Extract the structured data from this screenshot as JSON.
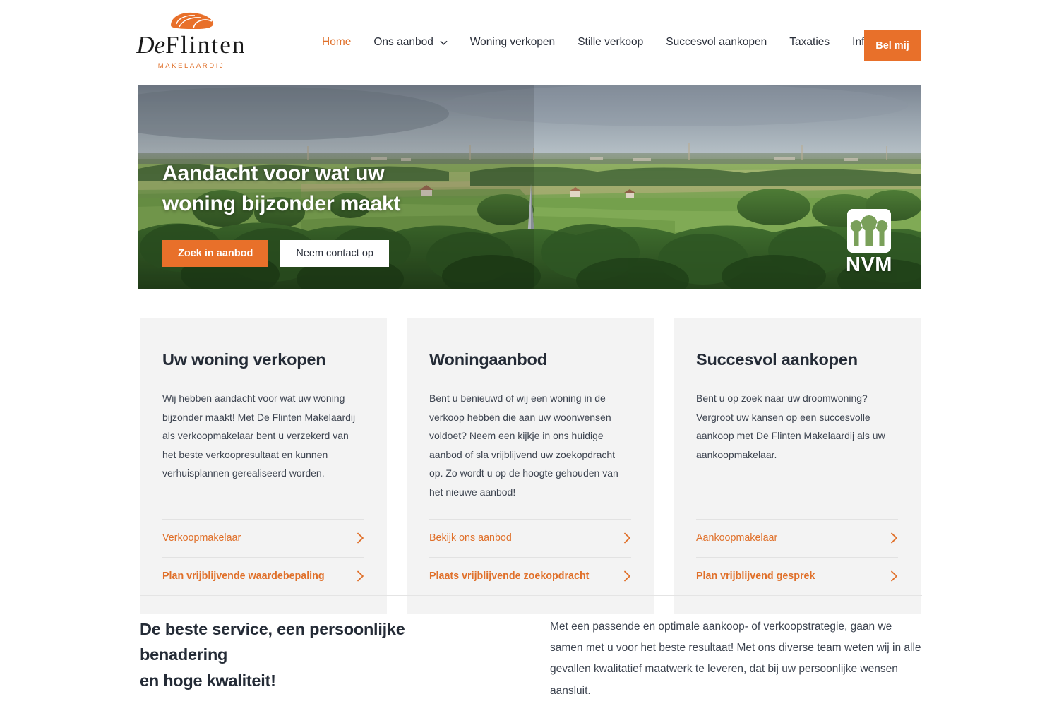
{
  "header": {
    "logo": {
      "mark_icon": "flint-stone-icon",
      "word_de": "De",
      "word_flinten": "Flinten",
      "tagline": "MAKELAARDIJ"
    },
    "nav": [
      {
        "label": "Home",
        "active": true,
        "has_dropdown": false
      },
      {
        "label": "Ons aanbod",
        "active": false,
        "has_dropdown": true
      },
      {
        "label": "Woning verkopen",
        "active": false,
        "has_dropdown": false
      },
      {
        "label": "Stille verkoop",
        "active": false,
        "has_dropdown": false
      },
      {
        "label": "Succesvol aankopen",
        "active": false,
        "has_dropdown": false
      },
      {
        "label": "Taxaties",
        "active": false,
        "has_dropdown": false
      },
      {
        "label": "Informatie",
        "active": false,
        "has_dropdown": true
      }
    ],
    "cta_label": "Bel mij"
  },
  "hero": {
    "title_line1": "Aandacht voor wat uw",
    "title_line2": "woning bijzonder maakt",
    "primary_button": "Zoek in aanbod",
    "secondary_button": "Neem contact op",
    "badge": {
      "name": "nvm-logo",
      "text": "NVM"
    },
    "image_alt": "Luchtfoto van Nederlands landschap met kerktoren, velden en bomen"
  },
  "cards": [
    {
      "title": "Uw woning verkopen",
      "body": "Wij hebben aandacht voor wat uw woning bijzonder maakt! Met De Flinten Makelaardij als verkoopmakelaar bent u verzekerd van het beste verkoopresultaat en kunnen verhuisplannen gerealiseerd worden.",
      "links": [
        {
          "label": "Verkoopmakelaar",
          "bold": false
        },
        {
          "label": "Plan vrijblijvende waardebepaling",
          "bold": true
        }
      ]
    },
    {
      "title": "Woningaanbod",
      "body": "Bent u benieuwd of wij een woning in de verkoop hebben die aan uw woonwensen voldoet? Neem een kijkje in ons huidige aanbod of sla vrijblijvend uw zoekopdracht op. Zo wordt u op de hoogte gehouden van het nieuwe aanbod!",
      "links": [
        {
          "label": "Bekijk ons aanbod",
          "bold": false
        },
        {
          "label": "Plaats vrijblijvende zoekopdracht",
          "bold": true
        }
      ]
    },
    {
      "title": "Succesvol aankopen",
      "body": "Bent u op zoek naar uw droomwoning? Vergroot uw kansen op een succesvolle aankoop met De Flinten Makelaardij als uw aankoopmakelaar.",
      "links": [
        {
          "label": "Aankoopmakelaar",
          "bold": false
        },
        {
          "label": "Plan vrijblijvend gesprek",
          "bold": true
        }
      ]
    }
  ],
  "bottom": {
    "heading_line1": "De beste service, een persoonlijke benadering",
    "heading_line2": "en hoge kwaliteit!",
    "body": "Met een passende en optimale aankoop- of verkoopstrategie, gaan we samen met u voor het beste resultaat! Met ons diverse team weten wij in alle gevallen kwalitatief maatwerk te leveren, dat bij uw persoonlijke wensen aansluit."
  },
  "colors": {
    "accent_orange": "#E8702A",
    "link_orange": "#E0702A",
    "heading_dark": "#242B36",
    "card_background": "#F3F3F3",
    "page_background": "#FFFFFF"
  }
}
